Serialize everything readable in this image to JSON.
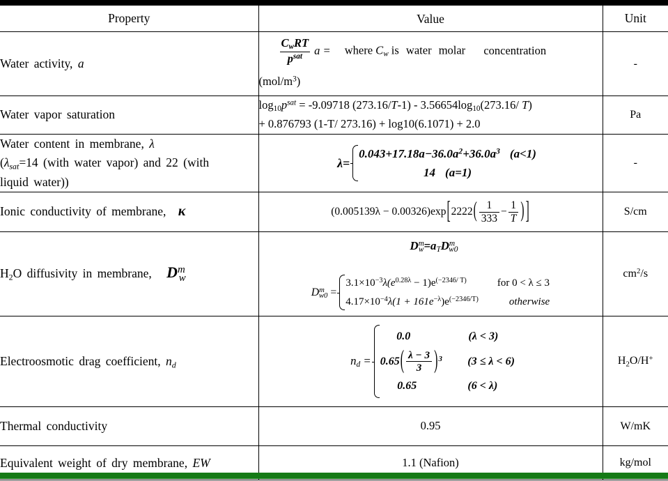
{
  "table": {
    "headers": {
      "property": "Property",
      "value": "Value",
      "unit": "Unit"
    },
    "rows": [
      {
        "property_text": "Water  activity, ",
        "property_sym": "a",
        "value_formula": "C_w RT / p^sat    a =  where C_w is water molar concentration (mol/m^3)",
        "value_parts": {
          "num": "C",
          "num_sub": "w",
          "num_rest": "RT",
          "den": "p",
          "den_sup": "sat",
          "a_eq": "a  = ",
          "words": "where",
          "cw": "C",
          "cw_sub": "w",
          "words2": "is  water  molar",
          "words3": "concentration",
          "mol": "(mol/m",
          "mol_sup": "3",
          "mol_end": ")"
        },
        "unit": "-"
      },
      {
        "property_text": "Water  vapor  saturation",
        "value_line1_a": "log",
        "value_line1_a_sub": "10",
        "value_line1_p": "p",
        "value_line1_p_sup": "sat",
        "value_line1_rest": " =  -9.09718  (273.16/",
        "value_line1_T": "T",
        "value_line1_rest2": "-1)  -  3.56654log",
        "value_line1_sub2": "10",
        "value_line1_rest3": "(273.16/ ",
        "value_line1_T2": "T",
        "value_line1_rest4": ")",
        "value_line2": "+  0.876793  (1-T/  273.16)  +  log10(6.1071)  +  2.0",
        "unit": "Pa"
      },
      {
        "property_line1": "Water  content  in  membrane, ",
        "property_line1_sym": "λ",
        "property_line2_a": "(",
        "property_line2_lam": "λ",
        "property_line2_sub": "sat",
        "property_line2_b": "=14  (with  water  vapor)  and  22  (with",
        "property_line3": "liquid  water))",
        "value_lhs": "λ=",
        "value_case1": "0.043+17.18a−36.0a",
        "value_case1_sup": "2",
        "value_case1_b": "+36.0a",
        "value_case1_sup2": "3",
        "value_case1_cond": "(a<1)",
        "value_case2": "14",
        "value_case2_cond": "(a=1)",
        "unit": "-"
      },
      {
        "property_text": "Ionic  conductivity  of  membrane, ",
        "property_sym": "κ",
        "value_a": "(0.005139λ − 0.00326)exp",
        "value_b": "2222",
        "value_f1_num": "1",
        "value_f1_den": "333",
        "value_minus": "−",
        "value_f2_num": "1",
        "value_f2_den": "T",
        "unit": "S/cm"
      },
      {
        "property_text": "H",
        "property_sub": "2",
        "property_text2": "O  diffusivity  in  membrane, ",
        "property_sym_D": "D",
        "property_sym_sup": "m",
        "property_sym_sub": "w",
        "value_line1_D": "D",
        "value_line1_sup": "m",
        "value_line1_sub": "w",
        "value_line1_eq": "=a",
        "value_line1_aT": "T",
        "value_line1_D2": "D",
        "value_line1_D2sup": "m",
        "value_line1_D2sub": "w0",
        "value_lhs_D": "D",
        "value_lhs_sup": "m",
        "value_lhs_sub": "w0",
        "value_lhs_eq": " = ",
        "value_case1": "3.1×10",
        "value_case1_sup": "−3",
        "value_case1_b": "λ(e",
        "value_case1_sup2": "0.28λ",
        "value_case1_c": " − 1)e",
        "value_case1_sup3": "(−2346/ T)",
        "value_case1_cond": "for 0 < λ ≤ 3",
        "value_case2": "4.17×10",
        "value_case2_sup": "−4",
        "value_case2_b": "λ(1 + 161e",
        "value_case2_sup2": "−λ",
        "value_case2_c": ")e",
        "value_case2_sup3": "(−2346/T)",
        "value_case2_cond": "otherwise",
        "unit_a": "cm",
        "unit_sup": "2",
        "unit_b": "/s"
      },
      {
        "property_text": "Electroosmotic  drag  coefficient, ",
        "property_sym": "n",
        "property_sym_sub": "d",
        "value_lhs": "n",
        "value_lhs_sub": "d",
        "value_eq": " = ",
        "value_case1": "0.0",
        "value_case1_cond": "(λ < 3)",
        "value_case2": "0.65",
        "value_case2_num": "λ − 3",
        "value_case2_den": "3",
        "value_case2_sup": "3",
        "value_case2_cond": "(3 ≤ λ < 6)",
        "value_case3": "0.65",
        "value_case3_cond": "(6 < λ)",
        "unit_a": "H",
        "unit_sub": "2",
        "unit_b": "O/H",
        "unit_sup": "+"
      },
      {
        "property_text": "Thermal  conductivity",
        "value": "0.95",
        "unit": "W/mK"
      },
      {
        "property_text": "Equivalent  weight  of  dry  membrane, ",
        "property_sym": "EW",
        "value": "1.1  (Nafion)",
        "unit": "kg/mol"
      }
    ]
  },
  "decor": {
    "top_bar_color": "#000000",
    "bottom_bar_color": "#157a16"
  }
}
